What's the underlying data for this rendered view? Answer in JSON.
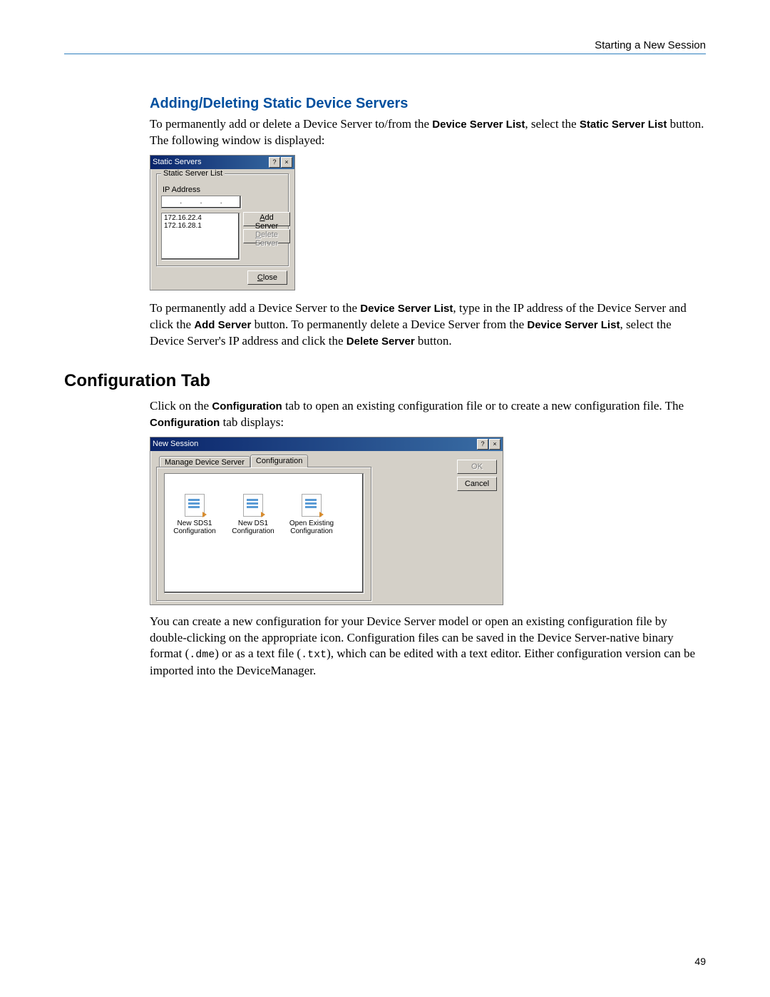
{
  "header": {
    "right_text": "Starting a New Session"
  },
  "page_number": "49",
  "section1": {
    "heading": "Adding/Deleting Static Device Servers",
    "para1_pre": "To permanently add or delete a Device Server to/from the ",
    "para1_b1": "Device Server List",
    "para1_mid": ", select the ",
    "para1_b2": "Static Server List",
    "para1_post": " button. The following window is displayed:",
    "para2_a": "To permanently add a Device Server to the ",
    "para2_b1": "Device Server List",
    "para2_b": ", type in the IP address of the Device Server and click the ",
    "para2_b2": "Add Server",
    "para2_c": " button. To permanently delete a Device Server from the ",
    "para2_b3": "Device Server List",
    "para2_d": ", select the Device Server's IP address and click the ",
    "para2_b4": "Delete Server",
    "para2_e": " button."
  },
  "static_dlg": {
    "title": "Static Servers",
    "group_legend": "Static Server List",
    "ip_label": "IP Address",
    "list": [
      "172.16.22.4",
      "172.16.28.1"
    ],
    "add_btn": "Add Server",
    "delete_btn": "Delete Server",
    "close_btn": "Close"
  },
  "section2": {
    "heading": "Configuration Tab",
    "para1_a": "Click on the ",
    "para1_b1": "Configuration",
    "para1_b": " tab to open an existing configuration file or to create a new configuration file. The ",
    "para1_b2": "Configuration",
    "para1_c": " tab displays:",
    "para2_a": "You can create a new configuration for your Device Server model or open an existing configuration file by double-clicking on the appropriate icon. Configuration files can be saved in the Device Server-native binary format (",
    "code1": ".dme",
    "para2_b": ") or as a text file (",
    "code2": ".txt",
    "para2_c": "), which can be edited with a text editor. Either configuration version can be imported into the DeviceManager."
  },
  "session_dlg": {
    "title": "New Session",
    "tab1": "Manage Device Server",
    "tab2": "Configuration",
    "ok": "OK",
    "cancel": "Cancel",
    "icons": [
      {
        "l1": "New SDS1",
        "l2": "Configuration"
      },
      {
        "l1": "New DS1",
        "l2": "Configuration"
      },
      {
        "l1": "Open Existing",
        "l2": "Configuration"
      }
    ]
  }
}
